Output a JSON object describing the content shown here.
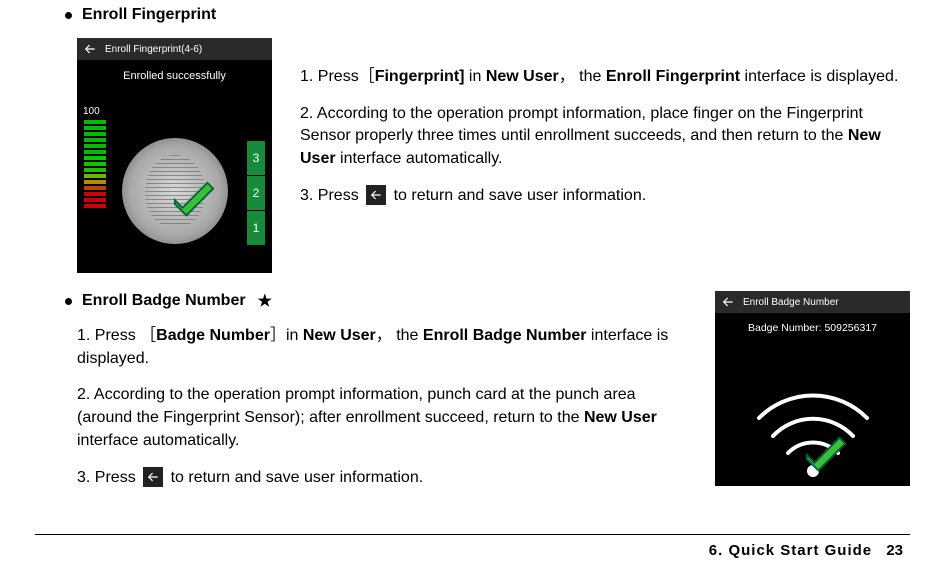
{
  "s1": {
    "heading": "Enroll Fingerprint",
    "shot": {
      "barTitle": "Enroll Fingerprint(4-6)",
      "status": "Enrolled successfully",
      "meterMax": "100",
      "sideNums": [
        "3",
        "2",
        "1"
      ]
    },
    "p1_a": "1. Press",
    "p1_b": "［",
    "p1_c": "Fingerprint]",
    "p1_d": " in ",
    "p1_e": "New User",
    "p1_f": "， the ",
    "p1_g": "Enroll Fingerprint",
    "p1_h": " interface is displayed.",
    "p2_a": "2. According to the operation prompt information, place finger on the Fingerprint Sensor properly three times until enrollment succeeds, and then return to the ",
    "p2_b": "New User",
    "p2_c": " interface automatically.",
    "p3_a": "3. Press ",
    "p3_b": " to return and save user information."
  },
  "s2": {
    "heading": "Enroll Badge Number",
    "p1_a": "1. Press ［",
    "p1_b": "Badge Number",
    "p1_c": "］in ",
    "p1_d": "New User",
    "p1_e": "， the ",
    "p1_f": "Enroll Badge Number",
    "p1_g": " interface is displayed.",
    "p2_a": "2. According to the operation prompt information, punch card at the punch area (around the Fingerprint Sensor); after enrollment succeed, return to the ",
    "p2_b": "New User",
    "p2_c": " interface automatically.",
    "p3_a": "3. Press ",
    "p3_b": " to return and save user information.",
    "shot": {
      "barTitle": "Enroll Badge Number",
      "badgeLine": "Badge Number: 509256317"
    }
  },
  "footer": {
    "chapter": "6.  Quick  Start  Guide",
    "page": "23"
  }
}
